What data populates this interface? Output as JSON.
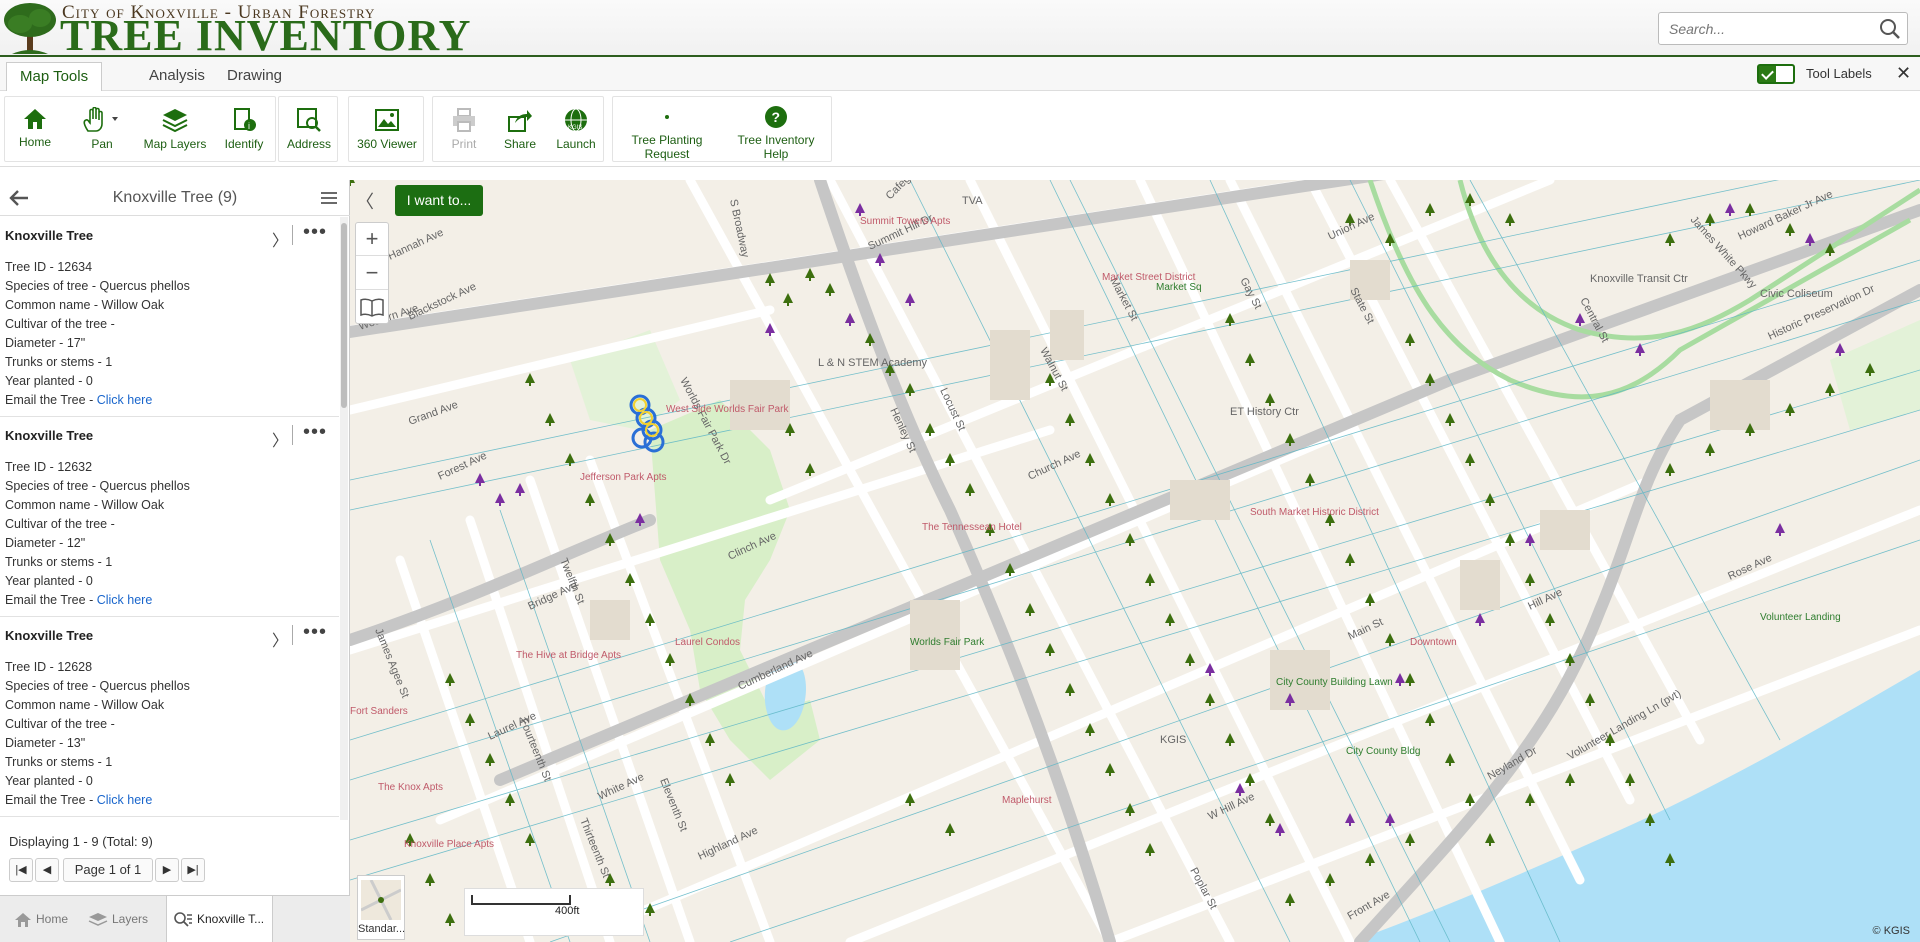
{
  "header": {
    "title_small": "City of Knoxville - Urban Forestry",
    "title_big": "TREE INVENTORY",
    "search_placeholder": "Search..."
  },
  "tabs": [
    {
      "label": "Map Tools",
      "active": true
    },
    {
      "label": "Analysis",
      "active": false
    },
    {
      "label": "Drawing",
      "active": false
    }
  ],
  "tool_labels": {
    "label": "Tool Labels",
    "checked": true
  },
  "toolbar": {
    "home": "Home",
    "pan": "Pan",
    "map_layers": "Map Layers",
    "identify": "Identify",
    "address": "Address",
    "viewer_360": "360 Viewer",
    "print": "Print",
    "share": "Share",
    "launch": "Launch",
    "tree_planting_1": "Tree Planting",
    "tree_planting_2": "Request",
    "tree_help_1": "Tree Inventory",
    "tree_help_2": "Help"
  },
  "panel": {
    "title": "Knoxville Tree (9)",
    "results": [
      {
        "title": "Knoxville Tree",
        "tree_id": "Tree ID - 12634",
        "species": "Species of tree - Quercus phellos",
        "common": "Common name - Willow Oak",
        "cultivar": "Cultivar of the tree -",
        "diameter": "Diameter - 17\"",
        "trunks": "Trunks or stems - 1",
        "year": "Year planted - 0",
        "email_label": "Email the Tree -",
        "email_link": "Click here"
      },
      {
        "title": "Knoxville Tree",
        "tree_id": "Tree ID - 12632",
        "species": "Species of tree - Quercus phellos",
        "common": "Common name - Willow Oak",
        "cultivar": "Cultivar of the tree -",
        "diameter": "Diameter - 12\"",
        "trunks": "Trunks or stems - 1",
        "year": "Year planted - 0",
        "email_label": "Email the Tree -",
        "email_link": "Click here"
      },
      {
        "title": "Knoxville Tree",
        "tree_id": "Tree ID - 12628",
        "species": "Species of tree - Quercus phellos",
        "common": "Common name - Willow Oak",
        "cultivar": "Cultivar of the tree -",
        "diameter": "Diameter - 13\"",
        "trunks": "Trunks or stems - 1",
        "year": "Year planted - 0",
        "email_label": "Email the Tree -",
        "email_link": "Click here"
      }
    ],
    "display_info": "Displaying 1 - 9 (Total: 9)",
    "page_text": "Page 1 of 1",
    "bottom_tabs": [
      "Home",
      "Layers",
      "Knoxville T..."
    ]
  },
  "map": {
    "i_want_to": "I want to...",
    "basemap_label": "Standar...",
    "scale_label": "400ft",
    "copyright": "© KGIS",
    "labels": {
      "streets": [
        "Western Ave",
        "Grand Ave",
        "Worlds Fair Park Dr",
        "Clinch Ave",
        "Cumberland Ave",
        "Henley St",
        "Locust St",
        "Walnut St",
        "Market St",
        "Gay St",
        "State St",
        "Union Ave",
        "Church Ave",
        "Main St",
        "Hill Ave",
        "Neyland Dr",
        "Volunteer Landing Ln (pvt)",
        "James White Pkwy",
        "Summit Hill Dr",
        "Laurel Ave",
        "White Ave",
        "Eleventh St",
        "Twelfth St",
        "Thirteenth St",
        "Fourteenth St",
        "Forest Ave",
        "Hannah Ave",
        "Blackstock Ave",
        "S Broadway",
        "Front Ave",
        "W Hill Ave",
        "Poplar St",
        "Howard Baker Jr Ave",
        "Historic Preservation Dr",
        "Central St",
        "Cafego Pl",
        "Rose Ave",
        "James Agee St",
        "Bridge Ave",
        "Highland Ave"
      ],
      "places": [
        "Summit Towers Apts",
        "TVA",
        "Market Street District",
        "Market Sq",
        "L & N STEM Academy",
        "West Side Worlds Fair Park",
        "Jefferson Park Apts",
        "The Tennessean Hotel",
        "ET History Ctr",
        "South Market Historic District",
        "Knoxville Transit Ctr",
        "Civic Coliseum",
        "City County Building Lawn",
        "KGIS",
        "City County Bldg",
        "Downtown",
        "Maplehurst",
        "Worlds Fair Park",
        "The Hive at Bridge Apts",
        "Fort Sanders",
        "The Knox Apts",
        "Knoxville Place Apts",
        "Volunteer Landing",
        "Laurel Condos"
      ]
    }
  }
}
